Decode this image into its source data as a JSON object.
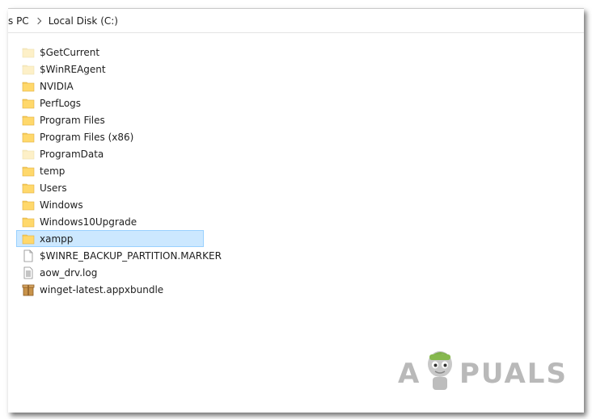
{
  "address_bar": {
    "path": [
      "s PC",
      "Local Disk (C:)"
    ]
  },
  "files": [
    {
      "name": "$GetCurrent",
      "type": "folder-hidden"
    },
    {
      "name": "$WinREAgent",
      "type": "folder-hidden"
    },
    {
      "name": "NVIDIA",
      "type": "folder"
    },
    {
      "name": "PerfLogs",
      "type": "folder"
    },
    {
      "name": "Program Files",
      "type": "folder"
    },
    {
      "name": "Program Files (x86)",
      "type": "folder"
    },
    {
      "name": "ProgramData",
      "type": "folder-hidden"
    },
    {
      "name": "temp",
      "type": "folder"
    },
    {
      "name": "Users",
      "type": "folder"
    },
    {
      "name": "Windows",
      "type": "folder"
    },
    {
      "name": "Windows10Upgrade",
      "type": "folder"
    },
    {
      "name": "xampp",
      "type": "folder",
      "selected": true
    },
    {
      "name": "$WINRE_BACKUP_PARTITION.MARKER",
      "type": "file"
    },
    {
      "name": "aow_drv.log",
      "type": "log"
    },
    {
      "name": "winget-latest.appxbundle",
      "type": "package"
    }
  ],
  "watermark": {
    "left": "A",
    "right": "PUALS"
  },
  "colors": {
    "folder": "#ffd86b",
    "folder_hidden": "#fdf0c8",
    "selection_bg": "#cce8ff",
    "selection_border": "#99d1ff"
  }
}
